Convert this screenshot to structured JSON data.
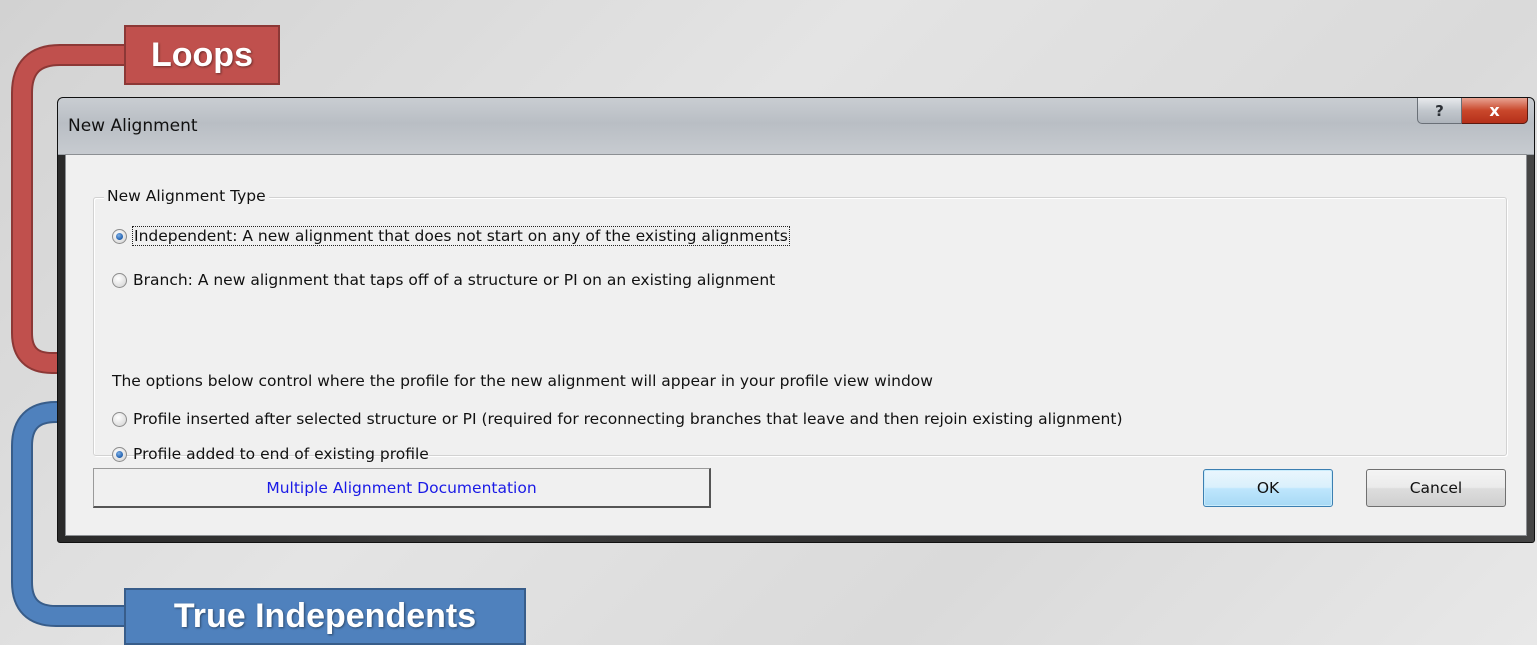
{
  "dialog": {
    "title": "New Alignment",
    "help_button": "?",
    "close_button": "x",
    "group_title": "New Alignment Type",
    "options": [
      {
        "label": "Independent: A new alignment that does not start on any of the existing alignments",
        "checked": true
      },
      {
        "label": "Branch: A new alignment that taps off of a structure or PI on an existing alignment",
        "checked": false
      }
    ],
    "profile_info": "The options below control where the profile for the new alignment will appear in your profile view window",
    "profile_options": [
      {
        "label": "Profile inserted after selected structure or PI (required for reconnecting branches that leave and then rejoin existing alignment)",
        "checked": false
      },
      {
        "label": "Profile added to end of existing profile",
        "checked": true
      }
    ],
    "docs_button": "Multiple Alignment Documentation",
    "ok_button": "OK",
    "cancel_button": "Cancel"
  },
  "callouts": {
    "loops": "Loops",
    "true_independents": "True Independents"
  },
  "colors": {
    "loops_callout": "#c0504d",
    "true_independents_callout": "#4f81bd",
    "docs_link": "#1a1ae6"
  }
}
